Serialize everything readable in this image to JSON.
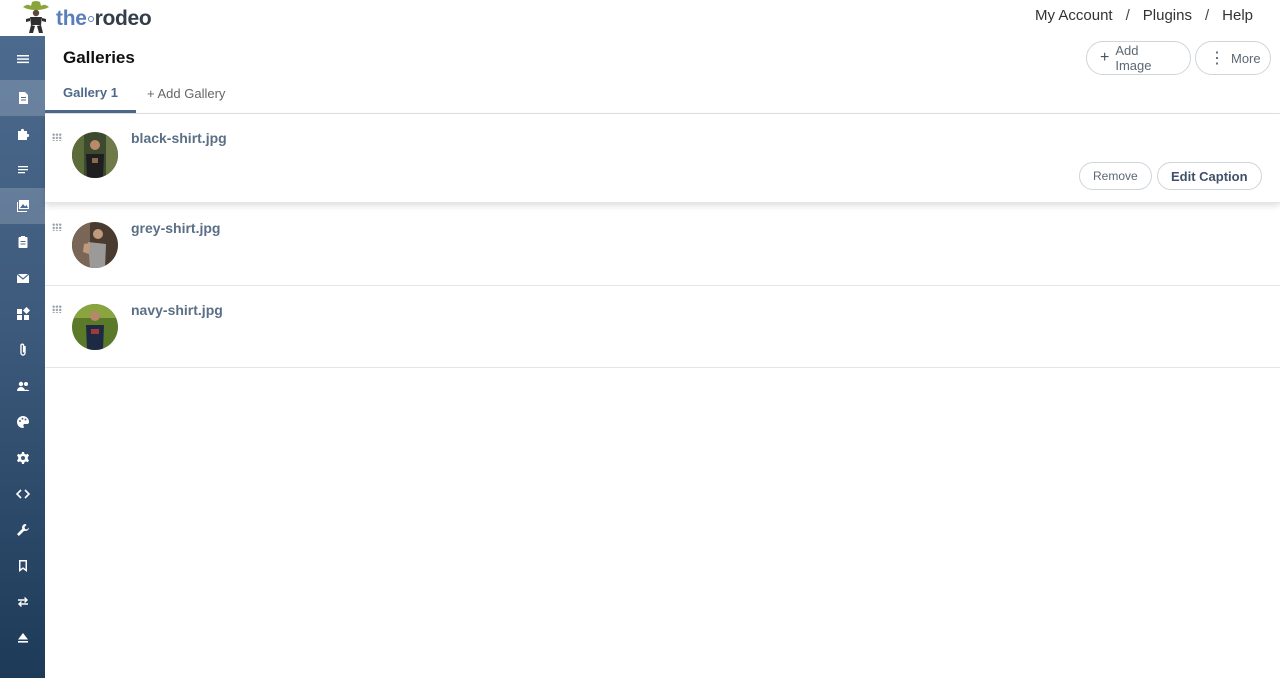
{
  "logo": {
    "part1": "the",
    "part2": "rodeo"
  },
  "topnav": {
    "my_account": "My Account",
    "plugins": "Plugins",
    "help": "Help",
    "separator": "/"
  },
  "sidebar": {
    "items": [
      {
        "icon": "menu-icon"
      },
      {
        "icon": "document-icon",
        "active": true
      },
      {
        "icon": "puzzle-icon"
      },
      {
        "icon": "lines-icon"
      },
      {
        "icon": "gallery-icon",
        "active": true
      },
      {
        "icon": "clipboard-icon"
      },
      {
        "icon": "mail-icon"
      },
      {
        "icon": "widgets-icon"
      },
      {
        "icon": "paperclip-icon"
      },
      {
        "icon": "users-icon"
      },
      {
        "icon": "palette-icon"
      },
      {
        "icon": "gear-icon"
      },
      {
        "icon": "code-icon"
      },
      {
        "icon": "wrench-icon"
      },
      {
        "icon": "bookmark-icon"
      },
      {
        "icon": "transfer-icon"
      },
      {
        "icon": "eject-icon"
      }
    ]
  },
  "header": {
    "title": "Galleries",
    "add_image": "Add Image",
    "more": "More"
  },
  "tabs": {
    "active": "Gallery 1",
    "add": "+ Add Gallery"
  },
  "images": [
    {
      "filename": "black-shirt.jpg"
    },
    {
      "filename": "grey-shirt.jpg"
    },
    {
      "filename": "navy-shirt.jpg"
    }
  ],
  "row_actions": {
    "remove": "Remove",
    "edit_caption": "Edit Caption"
  },
  "colors": {
    "accent": "#4d6888",
    "sidebar_top": "#4c6a8d",
    "sidebar_bottom": "#1d3a58"
  }
}
